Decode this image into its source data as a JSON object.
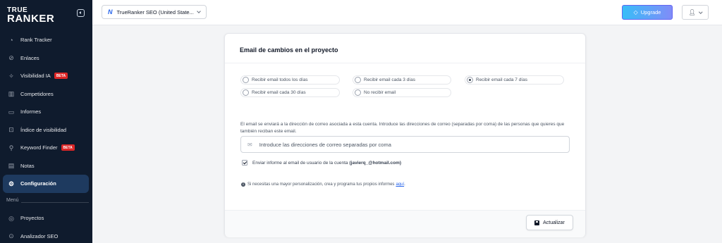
{
  "brand": {
    "line1": "TRUE",
    "line2": "RANKER"
  },
  "sidebar": {
    "items": [
      {
        "label": "Rank Tracker",
        "icon": "gauge-icon"
      },
      {
        "label": "Enlaces",
        "icon": "link-icon"
      },
      {
        "label": "Visibilidad IA",
        "icon": "sparkle-icon",
        "badge": "BETA"
      },
      {
        "label": "Competidores",
        "icon": "bar-chart-icon"
      },
      {
        "label": "Informes",
        "icon": "document-icon"
      },
      {
        "label": "Índice de visibilidad",
        "icon": "trend-icon"
      },
      {
        "label": "Keyword Finder",
        "icon": "key-icon",
        "badge": "BETA"
      },
      {
        "label": "Notas",
        "icon": "note-icon"
      },
      {
        "label": "Configuración",
        "icon": "gear-icon",
        "active": true
      }
    ],
    "section_label": "Menú",
    "items2": [
      {
        "label": "Proyectos",
        "icon": "globe-icon"
      },
      {
        "label": "Analizador SEO",
        "icon": "analyzer-icon"
      }
    ]
  },
  "topbar": {
    "project": "TrueRanker SEO (United State...",
    "upgrade_label": "Upgrade"
  },
  "card": {
    "title": "Email de cambios en el proyecto",
    "options": [
      {
        "label": "Recibir email todos los días",
        "checked": false
      },
      {
        "label": "Recibir email cada 3 días",
        "checked": false
      },
      {
        "label": "Recibir email cada 7 días",
        "checked": true
      },
      {
        "label": "Recibir email cada 30 días",
        "checked": false
      },
      {
        "label": "No recibir email",
        "checked": false
      }
    ],
    "help_text": "El email se enviará a la dirección de correo asociada a esta cuenta. Introduce las direcciones de correo (separadas por coma) de las personas que quieres que también reciban este email.",
    "email_placeholder": "Introduce las direcciones de correo separadas por coma",
    "checkbox_label": "Enviar informe al email de usuario de la cuenta",
    "account_email": "(javierq_@hotmail.com)",
    "info_text": "Si necesitas una mayor personalización, crea y programa tus propios informes",
    "info_link": "aquí",
    "info_end": ".",
    "update_label": "Actualizar"
  },
  "colors": {
    "sidebar_bg": "#0f1b2d",
    "active_bg": "#1e3a5f",
    "badge": "#dc2626",
    "link": "#2563eb"
  }
}
